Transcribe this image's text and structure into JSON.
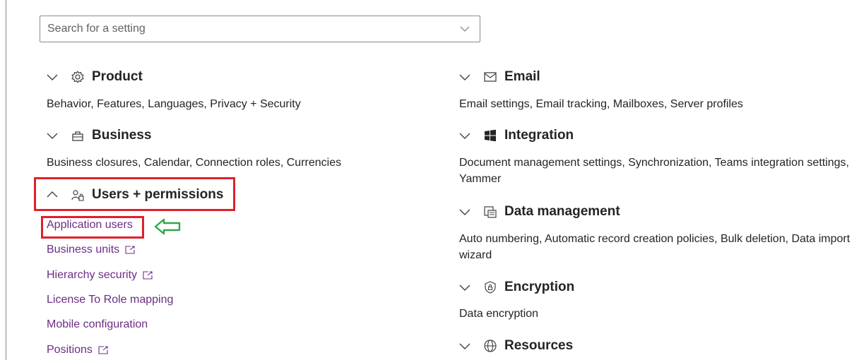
{
  "search": {
    "placeholder": "Search for a setting"
  },
  "left_sections": [
    {
      "title": "Product",
      "icon": "gear-icon",
      "expanded": false,
      "desc": "Behavior, Features, Languages, Privacy + Security"
    },
    {
      "title": "Business",
      "icon": "briefcase-icon",
      "expanded": false,
      "desc": "Business closures, Calendar, Connection roles, Currencies"
    },
    {
      "title": "Users + permissions",
      "icon": "users-lock-icon",
      "expanded": true,
      "links": [
        {
          "label": "Application users",
          "external": false
        },
        {
          "label": "Business units",
          "external": true
        },
        {
          "label": "Hierarchy security",
          "external": true
        },
        {
          "label": "License To Role mapping",
          "external": false
        },
        {
          "label": "Mobile configuration",
          "external": false
        },
        {
          "label": "Positions",
          "external": true
        }
      ]
    }
  ],
  "right_sections": [
    {
      "title": "Email",
      "icon": "mail-icon",
      "expanded": false,
      "desc": "Email settings, Email tracking, Mailboxes, Server profiles"
    },
    {
      "title": "Integration",
      "icon": "windows-icon",
      "expanded": false,
      "desc": "Document management settings, Synchronization, Teams integration settings, Yammer"
    },
    {
      "title": "Data management",
      "icon": "data-management-icon",
      "expanded": false,
      "desc": "Auto numbering, Automatic record creation policies, Bulk deletion, Data import wizard"
    },
    {
      "title": "Encryption",
      "icon": "shield-lock-icon",
      "expanded": false,
      "desc": "Data encryption"
    },
    {
      "title": "Resources",
      "icon": "globe-icon",
      "expanded": false
    }
  ],
  "colors": {
    "link": "#6b2d86",
    "highlight": "#e0202a",
    "arrow": "#2ea84a"
  }
}
